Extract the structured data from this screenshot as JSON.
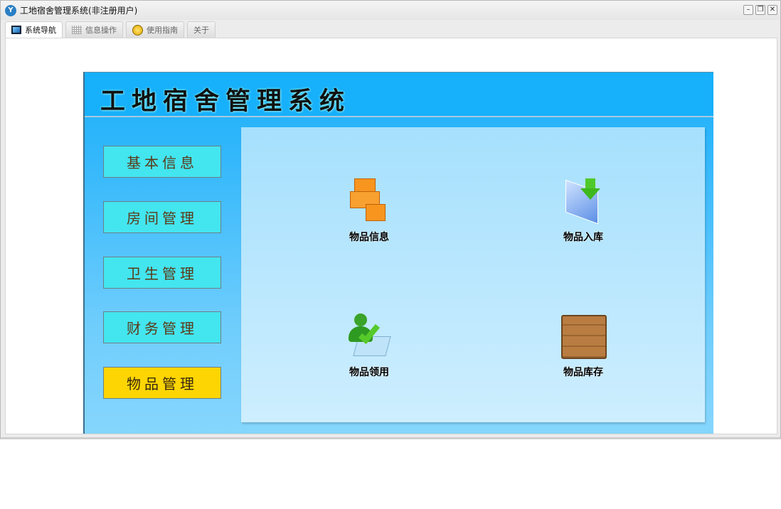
{
  "window": {
    "title": "工地宿舍管理系统(非注册用户)",
    "controls": [
      "minimize",
      "restore",
      "close"
    ]
  },
  "tabs": [
    {
      "label": "系统导航",
      "icon": "monitor-icon",
      "active": true
    },
    {
      "label": "信息操作",
      "icon": "grid-icon",
      "active": false
    },
    {
      "label": "使用指南",
      "icon": "help-icon",
      "active": false
    },
    {
      "label": "关于",
      "active": false
    }
  ],
  "app": {
    "title": "工地宿舍管理系统"
  },
  "sidebar": {
    "items": [
      {
        "label": "基本信息",
        "active": false
      },
      {
        "label": "房间管理",
        "active": false
      },
      {
        "label": "卫生管理",
        "active": false
      },
      {
        "label": "财务管理",
        "active": false
      },
      {
        "label": "物品管理",
        "active": true
      }
    ]
  },
  "main": {
    "items": [
      {
        "label": "物品信息",
        "icon": "boxes-icon"
      },
      {
        "label": "物品入库",
        "icon": "document-download-icon"
      },
      {
        "label": "物品领用",
        "icon": "user-check-icon"
      },
      {
        "label": "物品库存",
        "icon": "wooden-crate-icon"
      }
    ]
  },
  "colors": {
    "header": "#17b0fb",
    "nav_button": "#43e5ef",
    "nav_active": "#fdd502"
  }
}
